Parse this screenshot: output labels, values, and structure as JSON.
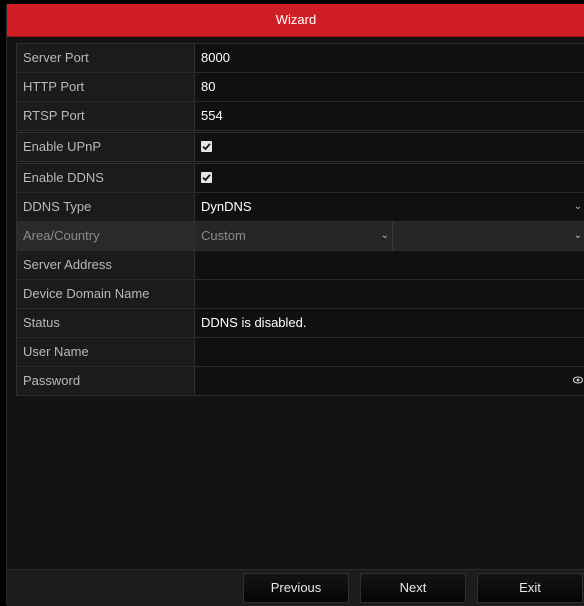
{
  "window": {
    "title": "Wizard"
  },
  "port_group": {
    "rows": [
      {
        "label": "Server Port",
        "value": "8000"
      },
      {
        "label": "HTTP Port",
        "value": "80"
      },
      {
        "label": "RTSP Port",
        "value": "554"
      }
    ]
  },
  "upnp": {
    "label": "Enable UPnP",
    "checked": true
  },
  "ddns": {
    "enable_label": "Enable DDNS",
    "enable_checked": true,
    "type_label": "DDNS Type",
    "type_value": "DynDNS",
    "area_label": "Area/Country",
    "area_value": "Custom",
    "area_second_value": "",
    "server_address_label": "Server Address",
    "server_address_value": "",
    "domain_label": "Device Domain Name",
    "domain_value": "",
    "status_label": "Status",
    "status_value": "DDNS is disabled.",
    "username_label": "User Name",
    "username_value": "",
    "password_label": "Password",
    "password_value": ""
  },
  "buttons": {
    "previous": "Previous",
    "next": "Next",
    "exit": "Exit"
  },
  "icons": {
    "dropdown": "chevron-down-icon",
    "checkbox": "check-icon",
    "password_toggle": "eye-icon"
  },
  "colors": {
    "title_bar": "#cf1f24",
    "background": "#131313"
  }
}
